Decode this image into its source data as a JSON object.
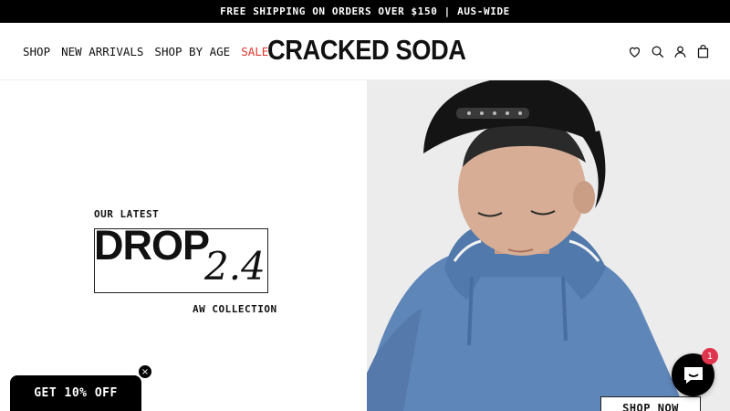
{
  "announcement": "FREE SHIPPING ON ORDERS OVER $150 | AUS-WIDE",
  "nav": {
    "shop": "SHOP",
    "new_arrivals": "NEW ARRIVALS",
    "shop_by_age": "SHOP BY AGE",
    "sale": "SALE"
  },
  "brand": "CRACKED SODA",
  "header_icons": [
    "heart-icon",
    "search-icon",
    "account-icon",
    "bag-icon"
  ],
  "hero": {
    "kicker": "OUR LATEST",
    "drop_word": "DROP",
    "drop_number": "2.4",
    "collection": "AW COLLECTION",
    "cta": "SHOP NOW"
  },
  "promo": {
    "label": "GET 10% OFF",
    "close": "×"
  },
  "chat": {
    "badge": "1"
  },
  "colors": {
    "sale": "#e0352b",
    "badge": "#e0354f",
    "hoodie": "#5f86b8"
  }
}
